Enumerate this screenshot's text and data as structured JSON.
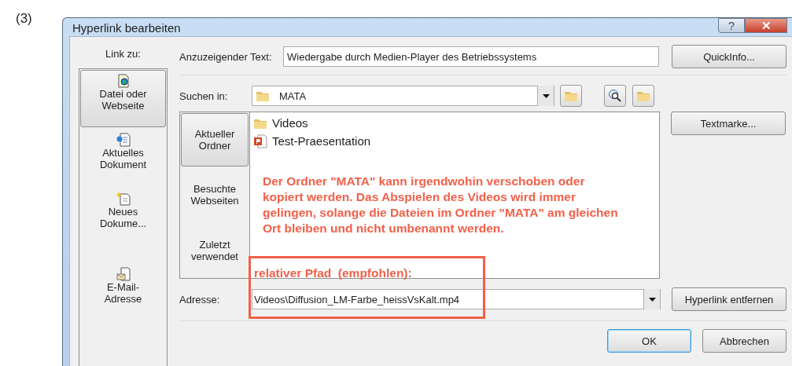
{
  "figure_label": "(3)",
  "window": {
    "title": "Hyperlink bearbeiten",
    "help_button": "?",
    "close_button": "✕"
  },
  "link_to": {
    "label": "Link zu:",
    "items": [
      {
        "label": "Datei oder Webseite",
        "kind": "file",
        "selected": true
      },
      {
        "label": "Aktuelles Dokument",
        "kind": "document",
        "selected": false
      },
      {
        "label": "Neues Dokume...",
        "kind": "new",
        "selected": false
      },
      {
        "label": "E-Mail-Adresse",
        "kind": "mail",
        "selected": false
      }
    ]
  },
  "display_text": {
    "label": "Anzuzeigender Text:",
    "value": "Wiedergabe durch Medien-Player des Betriebssystems"
  },
  "look_in": {
    "label": "Suchen in:",
    "value": "MATA"
  },
  "nav": [
    {
      "label": "Aktueller Ordner",
      "selected": true
    },
    {
      "label": "Besuchte Webseiten",
      "selected": false
    },
    {
      "label": "Zuletzt verwendet",
      "selected": false
    }
  ],
  "files": [
    {
      "name": "Videos",
      "kind": "folder"
    },
    {
      "name": "Test-Praesentation",
      "kind": "powerpoint"
    }
  ],
  "annotation": {
    "note": "Der Ordner \"MATA\" kann irgendwohin verschoben oder kopiert werden. Das Abspielen des Videos wird immer gelingen, solange die Dateien im Ordner \"MATA\" am gleichen Ort bleiben und nicht umbenannt werden.",
    "callout": "relativer Pfad  (empfohlen):"
  },
  "address": {
    "label": "Adresse:",
    "value": "Videos\\Diffusion_LM-Farbe_heissVsKalt.mp4"
  },
  "side_buttons": [
    {
      "label": "QuickInfo..."
    },
    {
      "label": "Textmarke..."
    },
    {
      "label": "Hyperlink entfernen"
    }
  ],
  "buttons": [
    {
      "label": "OK",
      "default": true
    },
    {
      "label": "Abbrechen",
      "default": false
    }
  ]
}
